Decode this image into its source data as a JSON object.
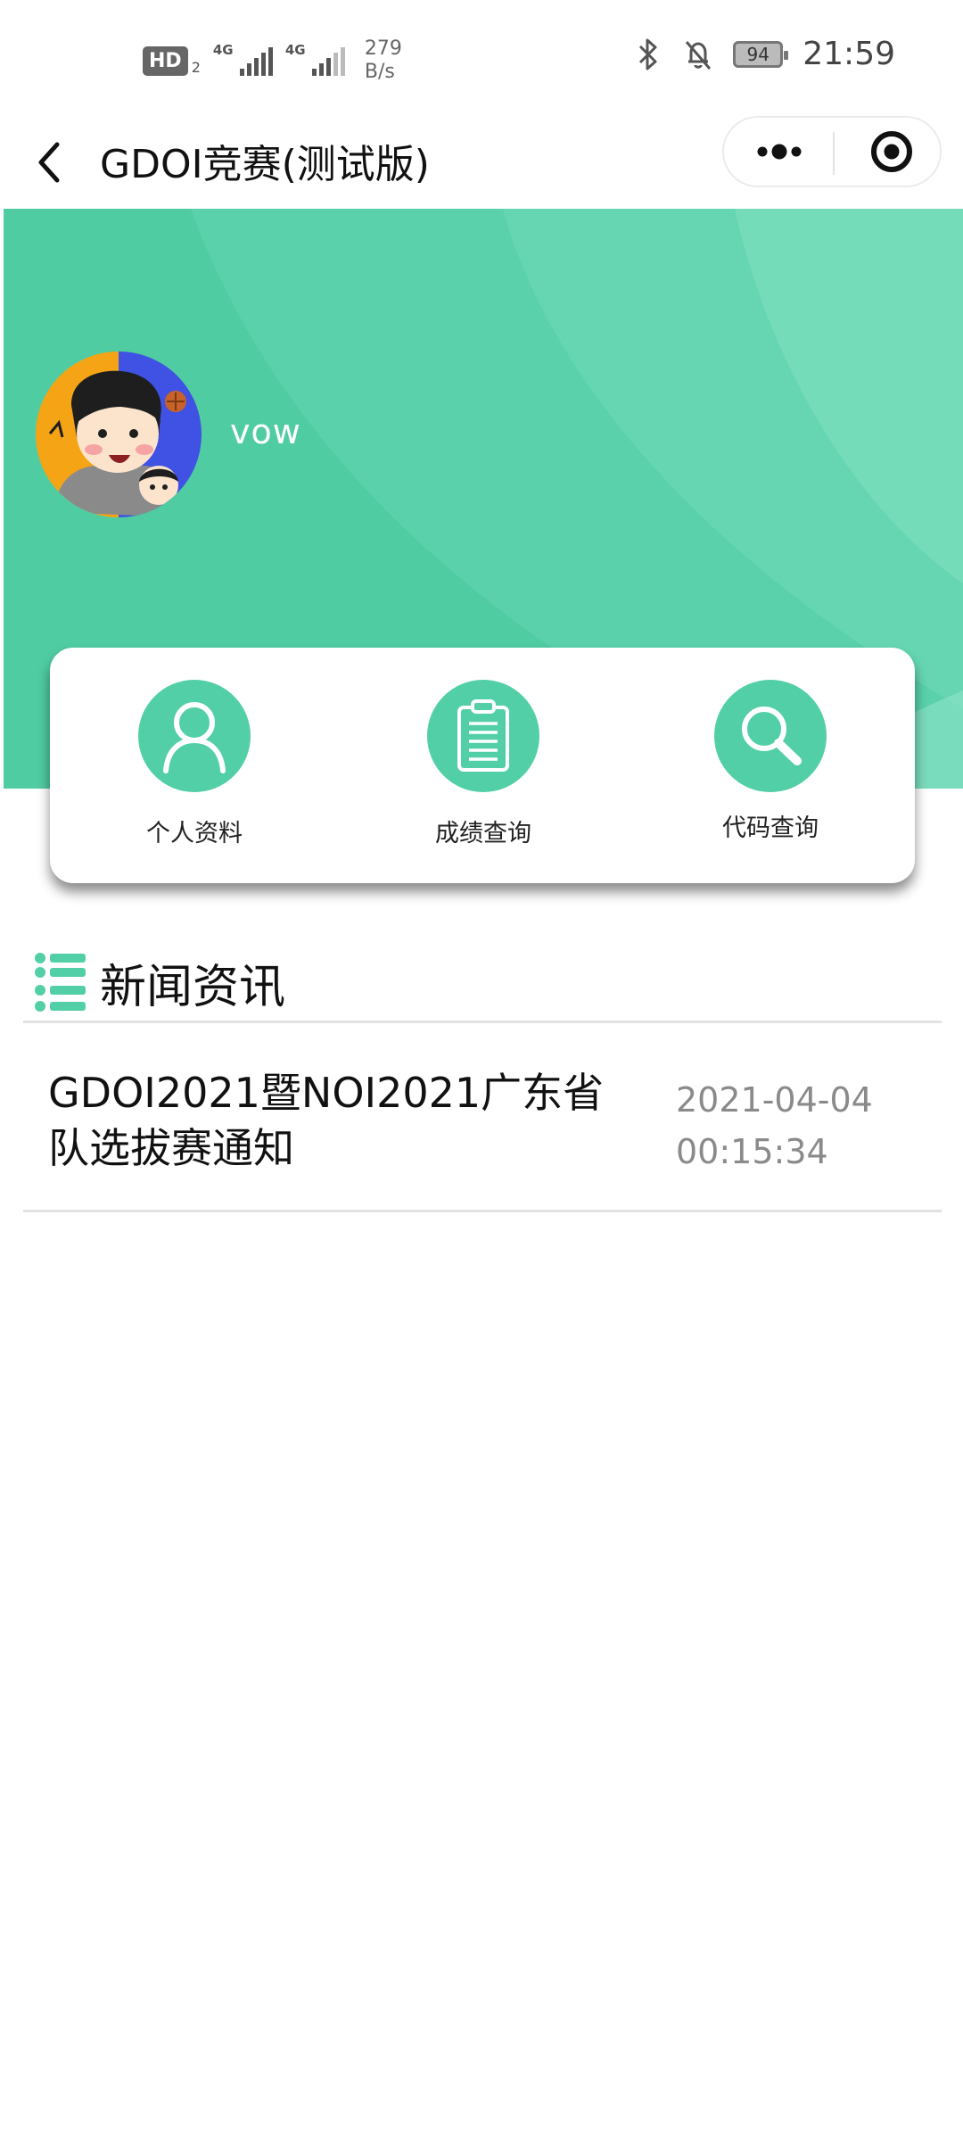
{
  "status_bar": {
    "hd_badge": "HD",
    "hd_sub": "2",
    "net1_label": "4G",
    "net2_label": "4G",
    "speed_value": "279",
    "speed_unit": "B/s",
    "battery": "94",
    "time": "21:59"
  },
  "nav": {
    "title": "GDOI竞赛(测试版)"
  },
  "profile": {
    "username": "vow"
  },
  "menu": {
    "items": [
      {
        "label": "个人资料",
        "icon": "person-icon"
      },
      {
        "label": "成绩查询",
        "icon": "clipboard-icon"
      },
      {
        "label": "代码查询",
        "icon": "search-icon"
      }
    ]
  },
  "news": {
    "section_title": "新闻资讯",
    "items": [
      {
        "title": "GDOI2021暨NOI2021广东省队选拔赛通知",
        "date": "2021-04-04",
        "time": "00:15:34"
      }
    ]
  },
  "colors": {
    "accent": "#52cfa6",
    "banner": "#55cfa6",
    "text": "#111111",
    "muted": "#8a8a8a"
  }
}
